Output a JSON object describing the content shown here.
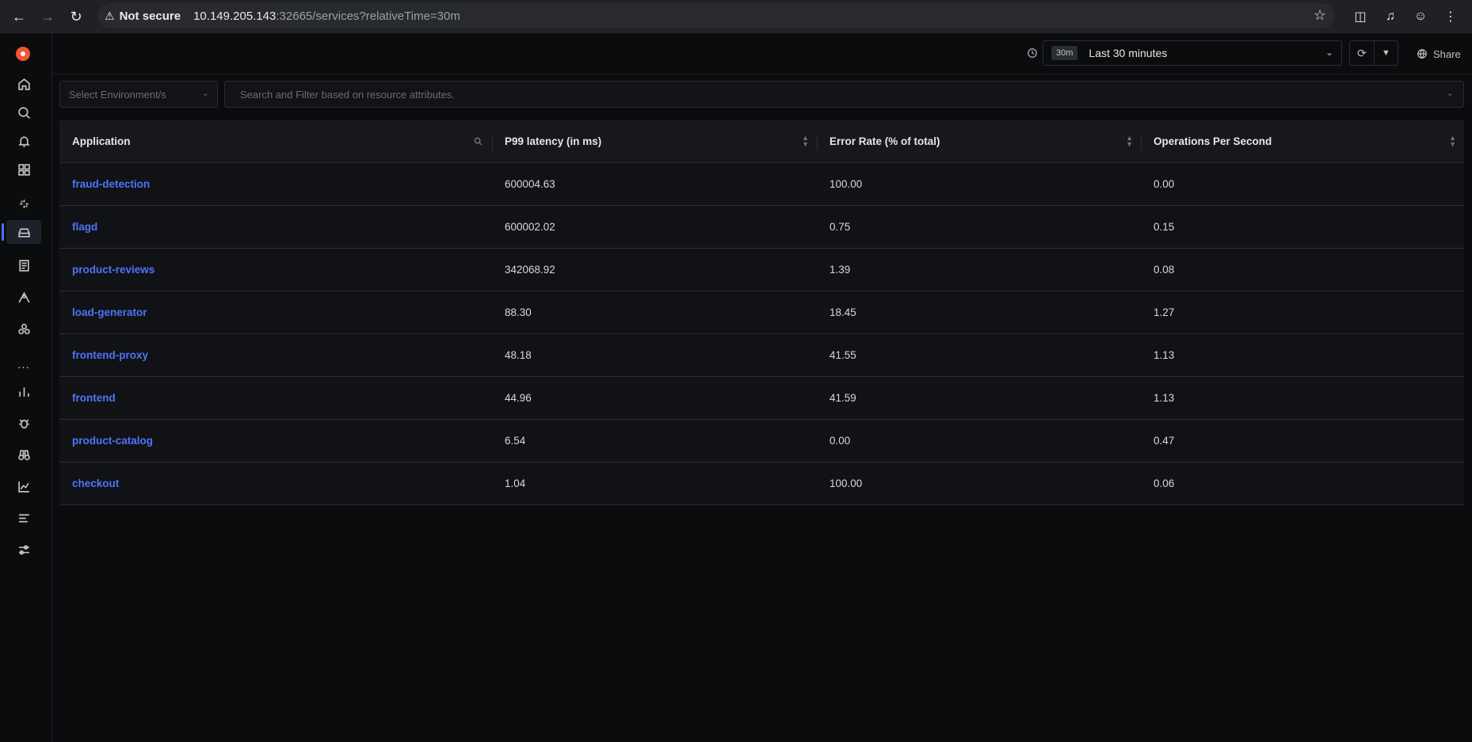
{
  "browser": {
    "security_label": "Not secure",
    "url_host": "10.149.205.143",
    "url_rest": ":32665/services?relativeTime=30m"
  },
  "header": {
    "time_badge": "30m",
    "time_label": "Last 30 minutes",
    "share_label": "Share"
  },
  "filters": {
    "environment_placeholder": "Select Environment/s",
    "search_placeholder": "Search and Filter based on resource attributes."
  },
  "table": {
    "columns": [
      "Application",
      "P99 latency (in ms)",
      "Error Rate (% of total)",
      "Operations Per Second"
    ],
    "rows": [
      {
        "application": "fraud-detection",
        "p99": "600004.63",
        "error_rate": "100.00",
        "ops": "0.00"
      },
      {
        "application": "flagd",
        "p99": "600002.02",
        "error_rate": "0.75",
        "ops": "0.15"
      },
      {
        "application": "product-reviews",
        "p99": "342068.92",
        "error_rate": "1.39",
        "ops": "0.08"
      },
      {
        "application": "load-generator",
        "p99": "88.30",
        "error_rate": "18.45",
        "ops": "1.27"
      },
      {
        "application": "frontend-proxy",
        "p99": "48.18",
        "error_rate": "41.55",
        "ops": "1.13"
      },
      {
        "application": "frontend",
        "p99": "44.96",
        "error_rate": "41.59",
        "ops": "1.13"
      },
      {
        "application": "product-catalog",
        "p99": "6.54",
        "error_rate": "0.00",
        "ops": "0.47"
      },
      {
        "application": "checkout",
        "p99": "1.04",
        "error_rate": "100.00",
        "ops": "0.06"
      }
    ]
  },
  "colors": {
    "accent": "#4e74f8",
    "brand": "#f25733",
    "background": "#0b0c0e"
  }
}
